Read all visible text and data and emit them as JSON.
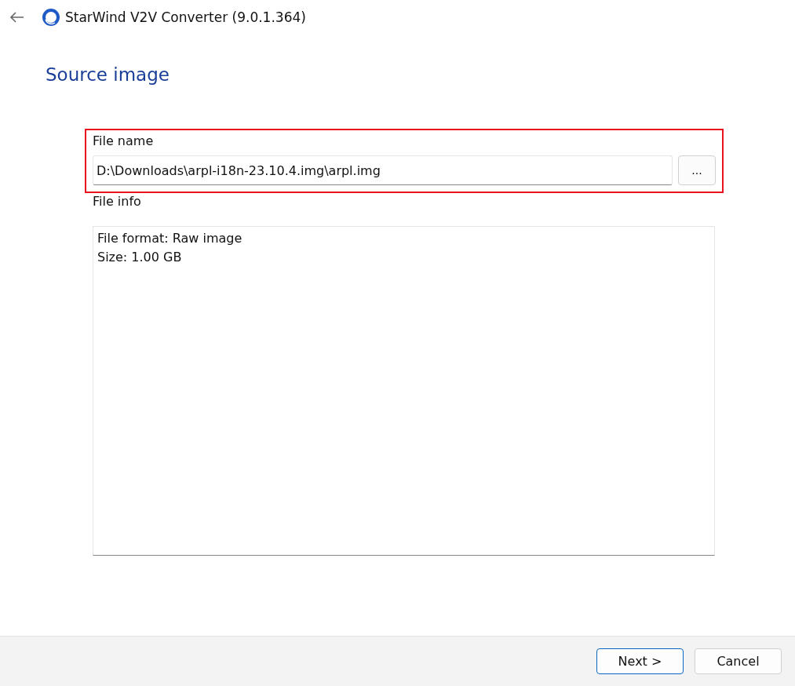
{
  "window": {
    "title": "StarWind V2V Converter (9.0.1.364)"
  },
  "page_title": "Source image",
  "file_name": {
    "label": "File name",
    "value": "D:\\Downloads\\arpl-i18n-23.10.4.img\\arpl.img",
    "browse_button": "...",
    "highlighted": true
  },
  "file_info": {
    "label": "File info",
    "lines": [
      "File format: Raw image",
      "Size: 1.00 GB"
    ]
  },
  "buttons": [
    {
      "label": "Next >",
      "default": true
    },
    {
      "label": "Cancel",
      "default": false
    }
  ]
}
